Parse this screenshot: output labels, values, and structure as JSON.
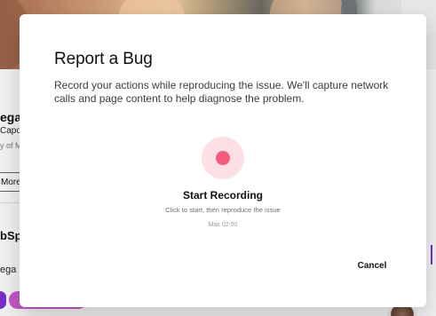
{
  "background": {
    "profile_name_fragment": "ega",
    "profile_role_fragment": "Capo",
    "profile_org_fragment": "y of M",
    "more_button_fragment": "More",
    "section_title_fragment": "bSp",
    "section_text_fragment": "ega i"
  },
  "modal": {
    "title": "Report a Bug",
    "description": "Record your actions while reproducing the issue. We'll capture network calls and page content to help diagnose the problem.",
    "record": {
      "icon": "record-icon",
      "label": "Start Recording",
      "hint": "Click to start, then reproduce the issue",
      "max": "Max 02:00"
    },
    "actions": {
      "cancel_label": "Cancel"
    }
  },
  "colors": {
    "record_outer": "#fde0e5",
    "record_dot": "#f25c7a",
    "accent_purple": "#7c2fd0"
  }
}
